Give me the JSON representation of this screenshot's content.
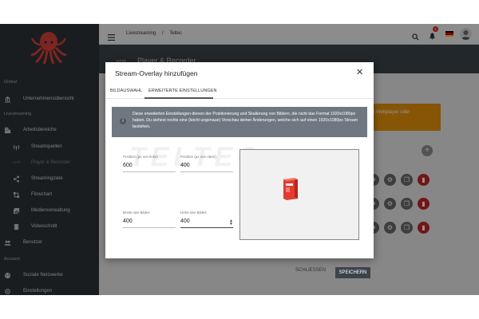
{
  "sidebar": {
    "sections": [
      {
        "label": "Global"
      },
      {
        "label": "Livestreaming"
      },
      {
        "label": "Account"
      }
    ],
    "items": [
      {
        "label": "Unternehmensübersicht",
        "icon": "bank-icon"
      },
      {
        "label": "Arbeitsbereiche",
        "icon": "building-icon"
      },
      {
        "label": "Streamquellen",
        "icon": "antenna-icon"
      },
      {
        "label": "Player & Recorder",
        "icon": "http-icon",
        "icon_text": "HTTP"
      },
      {
        "label": "Streamingziele",
        "icon": "share-icon"
      },
      {
        "label": "Flowchart",
        "icon": "flowchart-icon"
      },
      {
        "label": "Medienverwaltung",
        "icon": "media-icon"
      },
      {
        "label": "Videoschnitt",
        "icon": "film-icon"
      },
      {
        "label": "Benutzer",
        "icon": "users-icon"
      },
      {
        "label": "Soziale Netzwerke",
        "icon": "globe-icon"
      },
      {
        "label": "Einstellungen",
        "icon": "gear-icon"
      }
    ]
  },
  "topbar": {
    "breadcrumbs": [
      "Livestreaming",
      "/",
      "Teltec"
    ],
    "notification_count": "1"
  },
  "page": {
    "title": "Player & Recorder",
    "title_prefix": "HTTP",
    "banner_text": "n Webplayer oder"
  },
  "modal": {
    "title": "Stream-Overlay hinzufügen",
    "tabs": [
      "BILDAUSWAHL",
      "ERWEITERTE EINSTELLUNGEN"
    ],
    "info_text": "Diese erweiterten Einstellungen dienen der Positionierung und Skalierung von Bildern, die nicht das Format 1920x1080px haben. Du siehest rechts eine (leicht ungenaue) Vorschau deiner Änderungen, welche sich auf einen 1920x1080px Stream beziehen.",
    "watermark": "TELTEC",
    "fields": {
      "pos_x": {
        "label": "Position (px von links)",
        "value": "600"
      },
      "pos_y": {
        "label": "Position (px von oben)",
        "value": "400"
      },
      "width": {
        "label": "Breite des Bildes",
        "value": "400"
      },
      "height": {
        "label": "Höhe des Bildes",
        "value": "400"
      }
    },
    "buttons": {
      "close": "SCHLIESSEN",
      "save": "SPEICHERN"
    }
  },
  "colors": {
    "sidebar_bg": "#2d3338",
    "logo": "#d8403a",
    "banner": "#e8930c",
    "danger": "#c52525",
    "save_button": "#3c444b"
  }
}
